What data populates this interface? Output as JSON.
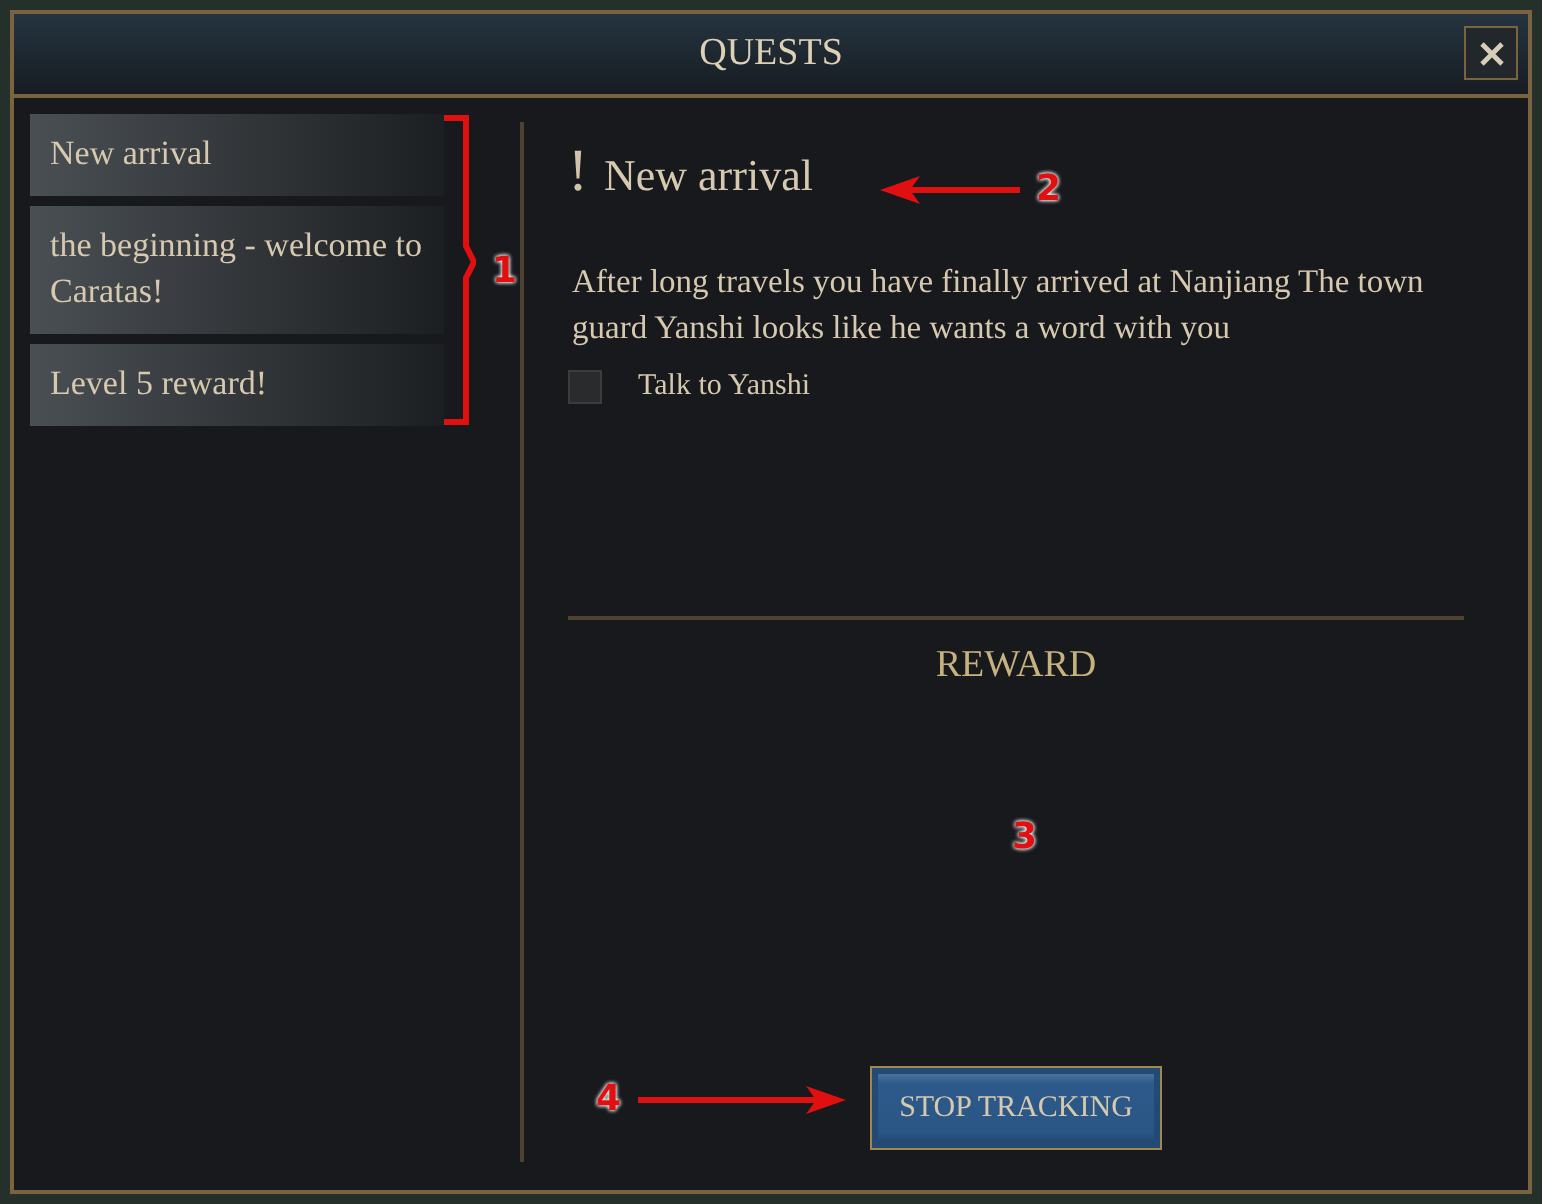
{
  "window": {
    "title": "QUESTS"
  },
  "quests": [
    {
      "title": "New arrival"
    },
    {
      "title": "the beginning - welcome to Caratas!"
    },
    {
      "title": "Level 5 reward!"
    }
  ],
  "detail": {
    "marker": "!",
    "title": "New arrival",
    "description": "After long travels you have finally arrived at Nanjiang The town guard Yanshi looks like he wants a word with you",
    "objectives": [
      {
        "label": "Talk to Yanshi",
        "checked": false
      }
    ],
    "reward_heading": "REWARD"
  },
  "button": "STOP TRACKING",
  "annotations": [
    {
      "kind": "bracket",
      "label": "1"
    },
    {
      "kind": "arrow-left",
      "label": "2"
    },
    {
      "kind": "number",
      "label": "3"
    },
    {
      "kind": "arrow-right",
      "label": "4"
    }
  ]
}
